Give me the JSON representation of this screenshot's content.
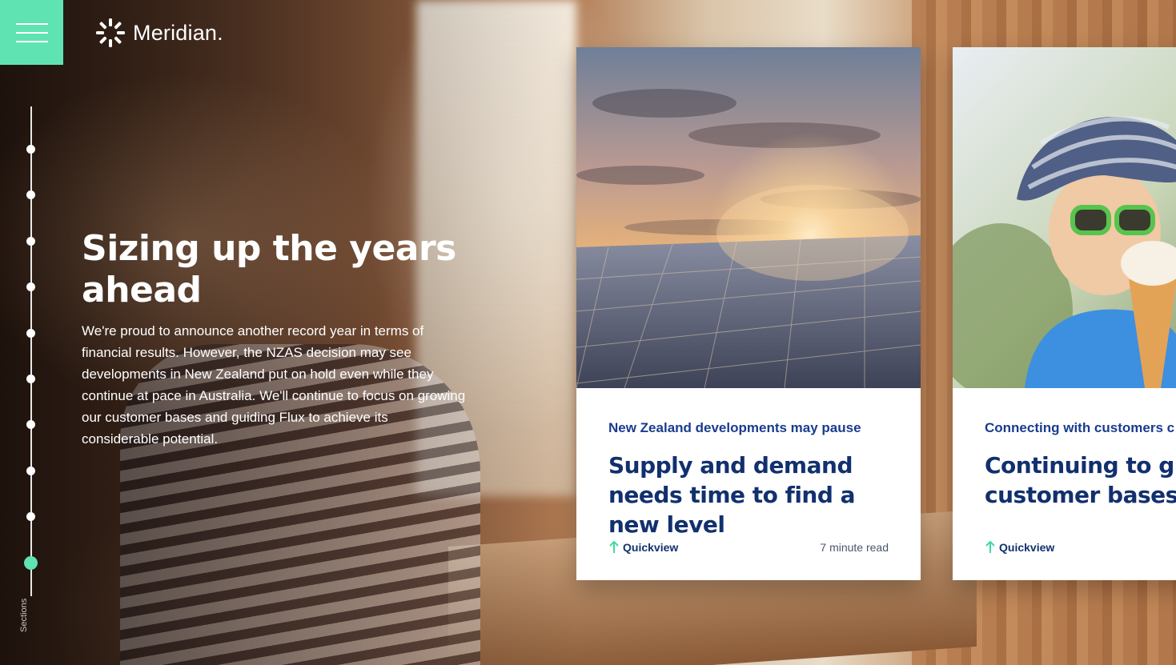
{
  "brand": {
    "logo_text": "Meridian.",
    "accent_color": "#5fe3b3",
    "navy_color": "#12306e"
  },
  "menu": {
    "icon": "hamburger-menu-icon"
  },
  "sections_rail": {
    "label": "Sections",
    "total_dots": 10,
    "active_index": 9
  },
  "hero": {
    "title": "Sizing up the years ahead",
    "body": "We're proud to announce another record year in terms of financial results. However, the NZAS decision may see developments in New Zealand put on hold even while they continue at pace in Australia. We'll continue to focus on growing our customer bases and guiding Flux to achieve its considerable potential."
  },
  "cards": [
    {
      "image": "solar-panels-sunset-photo",
      "kicker": "New Zealand developments may pause",
      "title": "Supply and demand needs time to find a new level",
      "quickview_label": "Quickview",
      "read_time": "7 minute read"
    },
    {
      "image": "child-with-ice-cream-photo",
      "kicker": "Connecting with customers c",
      "title": "Continuing to gro customer bases",
      "quickview_label": "Quickview",
      "read_time": ""
    }
  ]
}
